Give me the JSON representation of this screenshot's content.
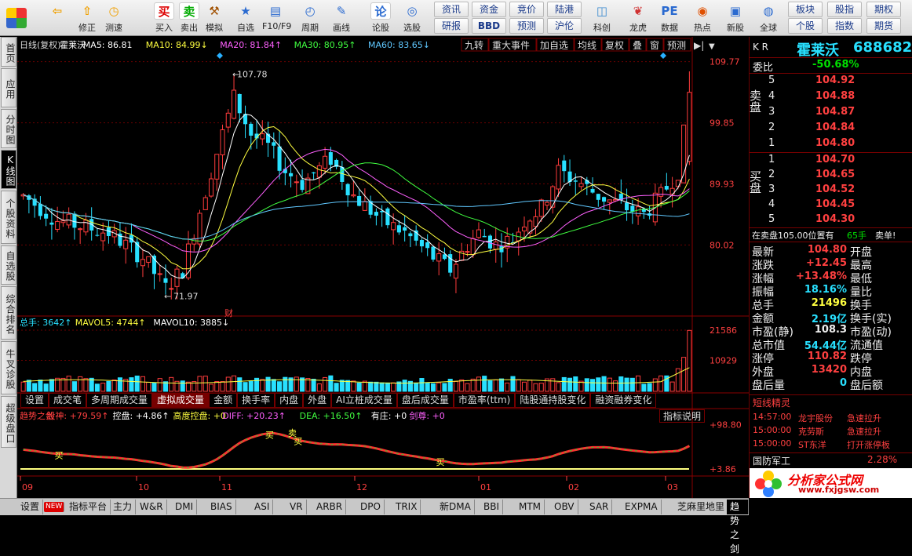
{
  "toolbar": {
    "big": [
      {
        "label": "",
        "icon": "app-logo-icon"
      },
      {
        "label": "",
        "icon": "back-arrow-icon"
      },
      {
        "label": "修正",
        "icon": "up-arrow-icon"
      },
      {
        "label": "测速",
        "icon": "timer-icon"
      },
      {
        "label": "买入",
        "icon": "buy-icon",
        "glyph": "买"
      },
      {
        "label": "卖出",
        "icon": "sell-icon",
        "glyph": "卖"
      },
      {
        "label": "模拟",
        "icon": "hammer-icon"
      },
      {
        "label": "自选",
        "icon": "star-icon"
      },
      {
        "label": "F10/F9",
        "icon": "f10-icon"
      },
      {
        "label": "周期",
        "icon": "clock-icon"
      },
      {
        "label": "画线",
        "icon": "pencil-icon"
      },
      {
        "label": "论股",
        "icon": "discuss-icon",
        "glyph": "论"
      },
      {
        "label": "选股",
        "icon": "select-icon"
      },
      {
        "label": "科创",
        "icon": "sci-icon"
      },
      {
        "label": "龙虎",
        "icon": "dragon-icon"
      },
      {
        "label": "数据",
        "icon": "pe-icon"
      },
      {
        "label": "热点",
        "icon": "hot-icon"
      },
      {
        "label": "新股",
        "icon": "ipo-icon"
      },
      {
        "label": "全球",
        "icon": "globe-icon"
      }
    ],
    "small": [
      "资讯",
      "资金",
      "竞价",
      "陆港",
      "研报",
      "BBD",
      "预测",
      "沪伦",
      "板块",
      "股指",
      "期权",
      "个股",
      "指数",
      "期货"
    ]
  },
  "left_tabs": [
    "首页",
    "应用",
    "分时图",
    "K线图",
    "个股资料",
    "自选股",
    "综合排名",
    "牛叉诊股",
    "超级盘口"
  ],
  "chart": {
    "title_line": [
      {
        "t": "日线(复权)",
        "c": "#dddddd"
      },
      {
        "t": "霍莱沃",
        "c": "#ffffff"
      },
      {
        "t": "MA5: 86.81",
        "c": "#ffffff"
      },
      {
        "t": "MA10: 84.99↓",
        "c": "#ffff40"
      },
      {
        "t": "MA20: 81.84↑",
        "c": "#ff60ff"
      },
      {
        "t": "MA30: 80.95↑",
        "c": "#40ff40"
      },
      {
        "t": "MA60: 83.65↓",
        "c": "#60c8ff"
      }
    ],
    "top_buttons": [
      "九转",
      "重大事件",
      "加自选",
      "均线",
      "复权",
      "叠",
      "窗",
      "预测"
    ],
    "price_axis": [
      "109.77",
      "99.85",
      "89.93",
      "80.02"
    ],
    "high_label": "107.78",
    "low_label": "71.97",
    "fin_marker": "财",
    "vol_title": [
      {
        "t": "总手: 3642↑",
        "c": "#28e0ff"
      },
      {
        "t": "MAVOL5: 4744↑",
        "c": "#ffff40"
      },
      {
        "t": "MAVOL10: 3885↓",
        "c": "#ffffff"
      }
    ],
    "vol_axis": [
      "21586",
      "10929"
    ],
    "tabs": [
      "设置",
      "成交笔",
      "多周期成交量",
      "虚拟成交量",
      "金额",
      "换手率",
      "内盘",
      "外盘",
      "AI立桩成交量",
      "盘后成交量",
      "市盈率(ttm)",
      "陆股通持股变化",
      "融资融券变化"
    ],
    "active_tab": "虚拟成交量",
    "ind_btn": "指标说明",
    "ind_title": [
      {
        "t": "趋势之剑",
        "c": "#ff4040"
      },
      {
        "t": "股神: +79.59↑",
        "c": "#ff4040"
      },
      {
        "t": "控盘: +4.86↑",
        "c": "#ffffff"
      },
      {
        "t": "高度控盘: +0",
        "c": "#ffff40"
      },
      {
        "t": "DIFF: +20.23↑",
        "c": "#ff60ff"
      },
      {
        "t": "DEA: +16.50↑",
        "c": "#40ff40"
      },
      {
        "t": "有庄: +0",
        "c": "#ffffff"
      },
      {
        "t": "剑尊: +0",
        "c": "#ff60ff"
      }
    ],
    "ind_axis": [
      "+98.80",
      "+3.86"
    ],
    "ind_marks": [
      "买",
      "卖",
      "买",
      "买",
      "买"
    ],
    "months": [
      "09",
      "10",
      "11",
      "12",
      "01",
      "02",
      "03"
    ]
  },
  "right": {
    "market": "K R",
    "name": "霍莱沃",
    "code": "688682",
    "weibi_label": "委比",
    "weibi": "-50.68%",
    "sell_label": "卖盘",
    "buy_label": "买盘",
    "sells": [
      {
        "n": "5",
        "p": "104.92"
      },
      {
        "n": "4",
        "p": "104.88"
      },
      {
        "n": "3",
        "p": "104.87"
      },
      {
        "n": "2",
        "p": "104.84"
      },
      {
        "n": "1",
        "p": "104.80"
      }
    ],
    "buys": [
      {
        "n": "1",
        "p": "104.70"
      },
      {
        "n": "2",
        "p": "104.65"
      },
      {
        "n": "3",
        "p": "104.52"
      },
      {
        "n": "4",
        "p": "104.45"
      },
      {
        "n": "5",
        "p": "104.30"
      }
    ],
    "notice": "在卖盘105.00位置有",
    "notice_hand": "65手",
    "notice_tail": "卖单!",
    "stats": [
      {
        "l": "最新",
        "v": "104.80",
        "r": "开盘",
        "c": "#ff4040"
      },
      {
        "l": "涨跌",
        "v": "+12.45",
        "r": "最高",
        "c": "#ff4040"
      },
      {
        "l": "涨幅",
        "v": "+13.48%",
        "r": "最低",
        "c": "#ff4040"
      },
      {
        "l": "振幅",
        "v": "18.16%",
        "r": "量比",
        "c": "#28e0ff"
      },
      {
        "l": "总手",
        "v": "21496",
        "r": "换手",
        "c": "#ffff40"
      },
      {
        "l": "金额",
        "v": "2.19亿",
        "r": "换手(实)",
        "c": "#28e0ff"
      },
      {
        "l": "市盈(静)",
        "v": "108.3",
        "r": "市盈(动)",
        "c": "#eeeeee"
      },
      {
        "l": "总市值",
        "v": "54.44亿",
        "r": "流通值",
        "c": "#28e0ff"
      },
      {
        "l": "涨停",
        "v": "110.82",
        "r": "跌停",
        "c": "#ff4040"
      },
      {
        "l": "外盘",
        "v": "13420",
        "r": "内盘",
        "c": "#ff4040"
      },
      {
        "l": "盘后量",
        "v": "0",
        "r": "盘后额",
        "c": "#28e0ff"
      }
    ],
    "short_title": "短线精灵",
    "short": [
      {
        "t": "14:57:00",
        "n": "龙宇股份",
        "e": "急速拉升"
      },
      {
        "t": "15:00:00",
        "n": "克劳斯",
        "e": "急速拉升"
      },
      {
        "t": "15:00:00",
        "n": "ST东洋",
        "e": "打开涨停板"
      }
    ],
    "sector": "国防军工",
    "sector_pct": "2.28%",
    "logo_text": "分析家公式网",
    "logo_url": "www.fxjgsw.com"
  },
  "bottom_tabs": [
    "设置",
    "NEW",
    "指标平台",
    "主力",
    "W&R",
    "DMI",
    "BIAS",
    "ASI",
    "VR",
    "ARBR",
    "DPO",
    "TRIX",
    "新DMA",
    "BBI",
    "MTM",
    "OBV",
    "SAR",
    "EXPMA",
    "芝麻里地里",
    "趋势之剑"
  ],
  "chart_data": {
    "type": "candlestick",
    "x_ticks": [
      "09",
      "10",
      "11",
      "12",
      "01",
      "02",
      "03"
    ],
    "price_ticks": [
      109.77,
      99.85,
      89.93,
      80.02
    ],
    "ylim": [
      69,
      111
    ],
    "high": 107.78,
    "low": 71.97,
    "last": 104.8,
    "ma": {
      "MA5": 86.81,
      "MA10": 84.99,
      "MA20": 81.84,
      "MA30": 80.95,
      "MA60": 83.65
    },
    "volume_ticks": [
      21586,
      10929
    ],
    "indicator_ticks": [
      98.8,
      3.86
    ]
  }
}
